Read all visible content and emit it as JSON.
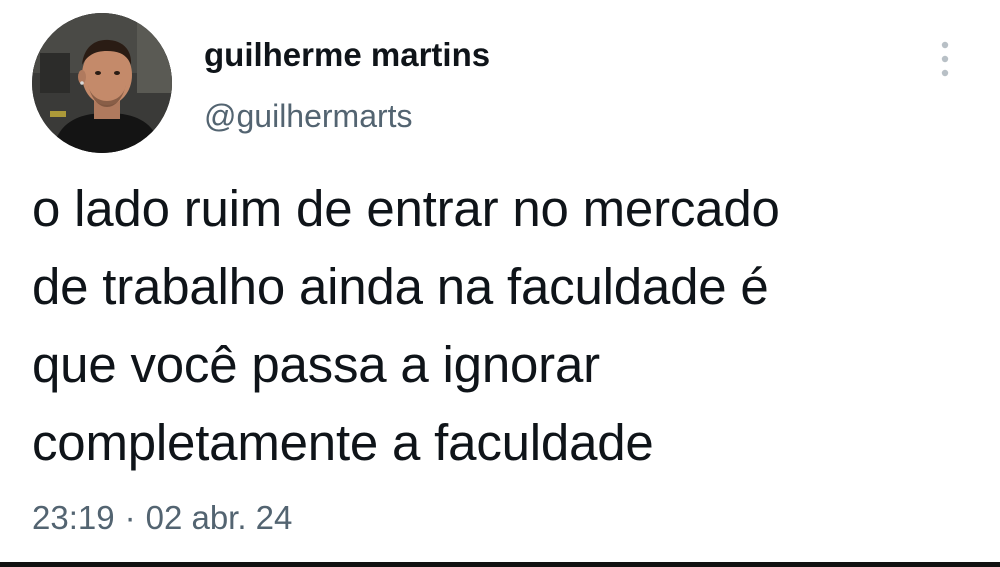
{
  "user": {
    "display_name": "guilherme martins",
    "handle": "@guilhermarts"
  },
  "tweet": {
    "lines": [
      "o lado ruim de entrar no mercado",
      "de trabalho ainda na faculdade é",
      "que você passa a ignorar",
      "completamente a faculdade"
    ],
    "time": "23:19",
    "separator": "·",
    "date": "02 abr. 24"
  },
  "icons": {
    "more": "more-vertical-icon",
    "avatar": "profile-photo"
  },
  "colors": {
    "text": "#0f1419",
    "secondary": "#536471",
    "background": "#ffffff"
  }
}
